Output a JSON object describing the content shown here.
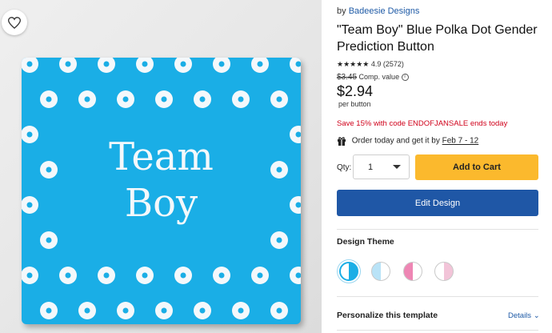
{
  "product": {
    "by_prefix": "by",
    "seller": "Badeesie Designs",
    "title": "\"Team Boy\" Blue Polka Dot Gender Prediction Button",
    "stars": "★★★★★",
    "rating": "4.9 (2572)",
    "original_price": "$3.45",
    "comp_value_label": "Comp. value",
    "price": "$2.94",
    "per_unit": "per button",
    "promo": "Save 15% with code ENDOFJANSALE ends today",
    "delivery_prefix": "Order today and get it by",
    "delivery_date": "Feb 7 - 12"
  },
  "image": {
    "line1": "Team",
    "line2": "Boy",
    "background_color": "#1aaee6",
    "dot_color": "#f4f8fb"
  },
  "order": {
    "qty_label": "Qty:",
    "qty_value": "1",
    "add_to_cart": "Add to Cart",
    "edit_design": "Edit Design"
  },
  "design_theme": {
    "label": "Design Theme",
    "swatches": [
      {
        "name": "blue",
        "left": "#ffffff",
        "right": "#1aaee6",
        "selected": true
      },
      {
        "name": "light-blue",
        "left": "#b9e3f7",
        "right": "#ffffff",
        "selected": false
      },
      {
        "name": "pink",
        "left": "#ee86b4",
        "right": "#ffffff",
        "selected": false
      },
      {
        "name": "light-pink",
        "left": "#ffffff",
        "right": "#f2c4d8",
        "selected": false
      }
    ]
  },
  "personalize": {
    "label": "Personalize this template",
    "details": "Details"
  },
  "colors": {
    "accent_yellow": "#fbb92d",
    "primary_blue": "#1f57a6",
    "promo_red": "#d0021b"
  }
}
